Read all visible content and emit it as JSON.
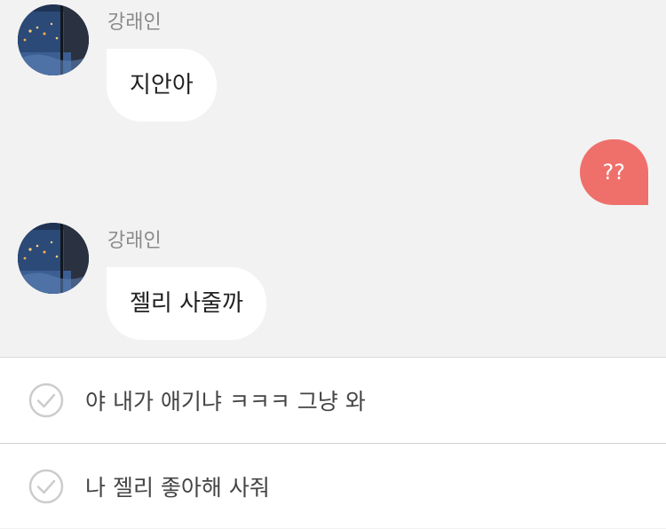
{
  "messages": [
    {
      "sender": "강래인",
      "text": "지안아",
      "direction": "incoming"
    },
    {
      "sender": "",
      "text": "??",
      "direction": "outgoing"
    },
    {
      "sender": "강래인",
      "text": "젤리 사줄까",
      "direction": "incoming"
    }
  ],
  "reply_options": [
    {
      "text": "야 내가 애기냐 ㅋㅋㅋ 그냥 와",
      "checked": false
    },
    {
      "text": "나 젤리 좋아해 사줘",
      "checked": false
    }
  ],
  "colors": {
    "background": "#f2f2f2",
    "incoming_bubble": "#ffffff",
    "outgoing_bubble": "#ef706a",
    "option_panel": "#ffffff",
    "check_icon": "#cccccc"
  }
}
